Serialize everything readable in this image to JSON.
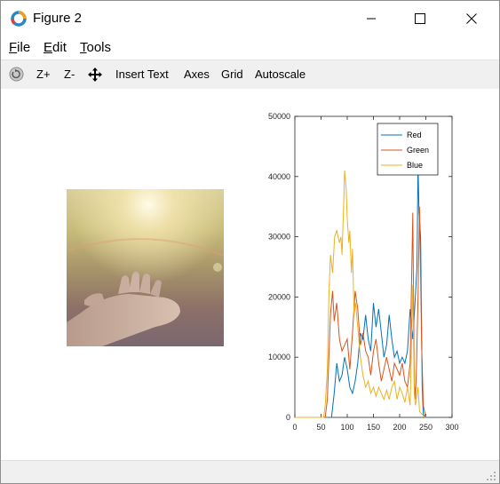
{
  "window": {
    "title": "Figure 2"
  },
  "menu": {
    "file": {
      "mnemonic": "F",
      "rest": "ile"
    },
    "edit": {
      "mnemonic": "E",
      "rest": "dit"
    },
    "tools": {
      "mnemonic": "T",
      "rest": "ools"
    }
  },
  "toolbar": {
    "rotate_icon": "rotate-icon",
    "zoom_in": "Z+",
    "zoom_out": "Z-",
    "pan_icon": "pan-icon",
    "insert_text": "Insert Text",
    "axes": "Axes",
    "grid": "Grid",
    "autoscale": "Autoscale"
  },
  "figure": {
    "image_subject": "open hand against warm sunset light",
    "chart_data": {
      "type": "line",
      "title": "",
      "xlabel": "",
      "ylabel": "",
      "xlim": [
        0,
        300
      ],
      "ylim": [
        0,
        50000
      ],
      "xticks": [
        "0",
        "50",
        "100",
        "150",
        "200",
        "250",
        "300"
      ],
      "yticks": [
        "0",
        "10000",
        "20000",
        "30000",
        "40000",
        "50000"
      ],
      "legend_position": "top-right",
      "grid": false,
      "series": [
        {
          "name": "Red",
          "color": "#0072bd",
          "x": [
            0,
            60,
            70,
            75,
            80,
            85,
            90,
            95,
            100,
            105,
            110,
            115,
            120,
            125,
            130,
            135,
            140,
            145,
            150,
            155,
            160,
            165,
            170,
            175,
            180,
            185,
            190,
            195,
            200,
            205,
            210,
            215,
            220,
            225,
            230,
            233,
            235,
            237,
            240,
            243,
            245,
            250,
            255
          ],
          "y": [
            0,
            0,
            0,
            4000,
            9000,
            6000,
            7000,
            10000,
            8000,
            5000,
            4000,
            6000,
            9000,
            14000,
            13000,
            17000,
            13000,
            11000,
            19000,
            15000,
            18000,
            14000,
            10000,
            12000,
            17000,
            13000,
            10000,
            11000,
            9000,
            10000,
            9000,
            11000,
            18000,
            13000,
            20000,
            25000,
            42000,
            34000,
            30000,
            5000,
            500,
            0,
            0
          ]
        },
        {
          "name": "Green",
          "color": "#d95319",
          "x": [
            0,
            58,
            62,
            65,
            68,
            72,
            75,
            80,
            85,
            90,
            95,
            100,
            105,
            110,
            115,
            120,
            125,
            130,
            135,
            140,
            145,
            150,
            155,
            160,
            165,
            170,
            175,
            180,
            185,
            190,
            195,
            200,
            205,
            210,
            215,
            220,
            225,
            228,
            230,
            232,
            235,
            238,
            242,
            245,
            250
          ],
          "y": [
            0,
            0,
            3000,
            10000,
            17000,
            21000,
            16000,
            19000,
            13000,
            11000,
            12000,
            13000,
            8000,
            14000,
            21000,
            18000,
            12000,
            14000,
            11000,
            10000,
            7000,
            11000,
            13000,
            9000,
            6000,
            8000,
            10000,
            8000,
            6000,
            9000,
            8000,
            7000,
            9000,
            6000,
            5000,
            9000,
            34000,
            6000,
            3000,
            8000,
            20000,
            35000,
            12000,
            2000,
            0
          ]
        },
        {
          "name": "Blue",
          "color": "#edb120",
          "x": [
            0,
            55,
            58,
            62,
            65,
            68,
            72,
            76,
            80,
            85,
            88,
            90,
            93,
            95,
            98,
            100,
            103,
            105,
            108,
            110,
            113,
            116,
            120,
            125,
            130,
            135,
            140,
            145,
            150,
            155,
            160,
            165,
            170,
            175,
            180,
            185,
            190,
            195,
            200,
            205,
            210,
            215,
            220,
            225,
            228,
            230,
            232,
            235,
            238,
            240,
            243,
            246,
            250
          ],
          "y": [
            0,
            0,
            2000,
            8000,
            20000,
            27000,
            24000,
            30000,
            31000,
            29000,
            30000,
            27000,
            35000,
            41000,
            38000,
            33000,
            29000,
            31000,
            24000,
            28000,
            17000,
            19000,
            15000,
            10000,
            7000,
            5000,
            6000,
            4000,
            5000,
            3500,
            5000,
            4000,
            3000,
            4500,
            3000,
            5000,
            6000,
            3000,
            5000,
            4000,
            2500,
            5000,
            2000,
            22000,
            4000,
            2000,
            3000,
            5000,
            1000,
            800,
            500,
            200,
            0
          ]
        }
      ]
    }
  }
}
